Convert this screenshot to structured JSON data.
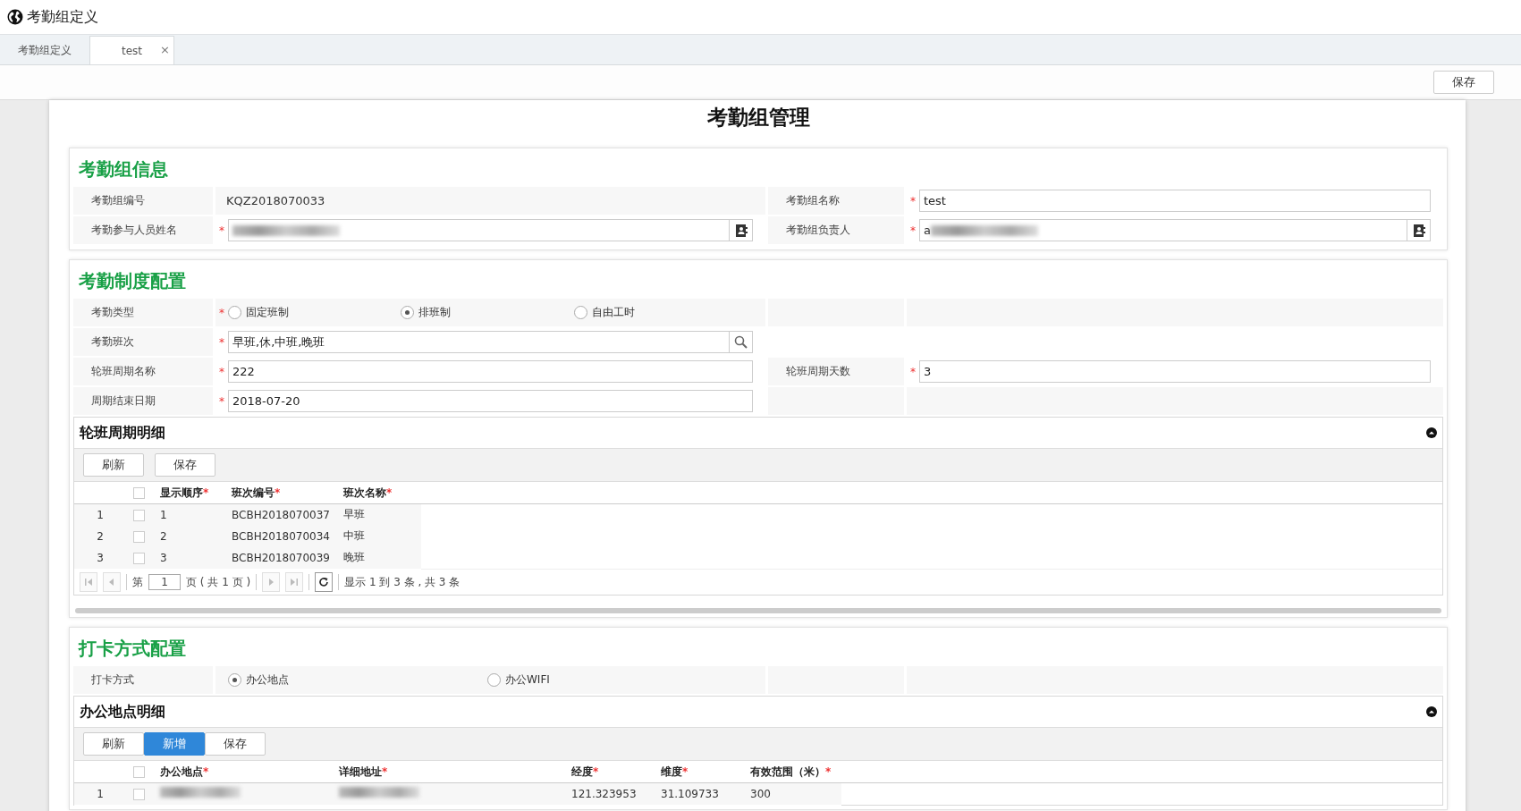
{
  "window": {
    "title": "考勤组定义"
  },
  "tabs": [
    {
      "label": "考勤组定义",
      "selected": false
    },
    {
      "label": "test",
      "selected": true,
      "close": "×"
    }
  ],
  "toolbar": {
    "save": "保存"
  },
  "page_title": "考勤组管理",
  "sections": [
    {
      "title": "考勤组信息",
      "rows": [
        {
          "left": {
            "label": "考勤组编号",
            "kind": "static",
            "value": "KQZ2018070033"
          },
          "right": {
            "label": "考勤组名称",
            "kind": "input",
            "required_mark": "*",
            "value": "test"
          }
        },
        {
          "left": {
            "label": "考勤参与人员姓名",
            "kind": "picker",
            "required_mark": "*",
            "redacted": true
          },
          "right": {
            "label": "考勤组负责人",
            "kind": "picker",
            "required_mark": "*",
            "value": "a",
            "redacted": true
          }
        }
      ]
    },
    {
      "title": "考勤制度配置",
      "rows": [
        {
          "left": {
            "label": "考勤类型",
            "kind": "radio",
            "required_mark": "*",
            "options": [
              {
                "label": "固定班制",
                "selected": false
              },
              {
                "label": "排班制",
                "selected": true
              },
              {
                "label": "自由工时",
                "selected": false
              }
            ]
          },
          "right": {
            "kind": "empty"
          }
        },
        {
          "left": {
            "label": "考勤班次",
            "kind": "search",
            "required_mark": "*",
            "value": "早班,休,中班,晚班"
          },
          "right": {
            "kind": "blank"
          }
        },
        {
          "left": {
            "label": "轮班周期名称",
            "kind": "input",
            "required_mark": "*",
            "value": "222"
          },
          "right": {
            "label": "轮班周期天数",
            "kind": "input",
            "required_mark": "*",
            "value": "3"
          }
        },
        {
          "left": {
            "label": "周期结束日期",
            "kind": "input",
            "required_mark": "*",
            "value": "2018-07-20"
          },
          "right": {
            "kind": "empty"
          }
        }
      ],
      "grid": {
        "title": "轮班周期明细",
        "buttons": [
          {
            "label": "刷新",
            "primary": false
          },
          {
            "label": "保存",
            "primary": false
          }
        ],
        "all_checked": false,
        "columns": [
          {
            "label": "显示顺序",
            "required_mark": "*"
          },
          {
            "label": "班次编号",
            "required_mark": "*"
          },
          {
            "label": "班次名称",
            "required_mark": "*"
          }
        ],
        "rows": [
          {
            "number": "1",
            "checked": false,
            "cells": [
              "1",
              "BCBH2018070037",
              "早班"
            ]
          },
          {
            "number": "2",
            "checked": false,
            "cells": [
              "2",
              "BCBH2018070034",
              "中班"
            ]
          },
          {
            "number": "3",
            "checked": false,
            "cells": [
              "3",
              "BCBH2018070039",
              "晚班"
            ]
          }
        ],
        "pager": {
          "page_prefix": "第",
          "page": "1",
          "page_suffix": "页 ( 共 1 页 )",
          "summary": "显示 1 到 3 条 , 共 3 条"
        }
      },
      "scrollbar": true
    },
    {
      "title": "打卡方式配置",
      "rows": [
        {
          "left": {
            "label": "打卡方式",
            "kind": "radio",
            "options": [
              {
                "label": "办公地点",
                "selected": true
              },
              {
                "label": "办公WIFI",
                "selected": false
              }
            ]
          },
          "right": {
            "kind": "empty"
          }
        }
      ],
      "grid": {
        "title": "办公地点明细",
        "buttons": [
          {
            "label": "刷新",
            "primary": false
          },
          {
            "label": "新增",
            "primary": true
          },
          {
            "label": "保存",
            "primary": false
          }
        ],
        "all_checked": false,
        "columns": [
          {
            "label": "办公地点",
            "required_mark": "*"
          },
          {
            "label": "详细地址",
            "required_mark": "*"
          },
          {
            "label": "经度",
            "required_mark": "*"
          },
          {
            "label": "维度",
            "required_mark": "*"
          },
          {
            "label": "有效范围（米）",
            "required_mark": "*"
          }
        ],
        "rows": [
          {
            "number": "1",
            "checked": false,
            "cells": [
              null,
              null,
              "121.323953",
              "31.109733",
              "300"
            ]
          }
        ]
      }
    }
  ]
}
